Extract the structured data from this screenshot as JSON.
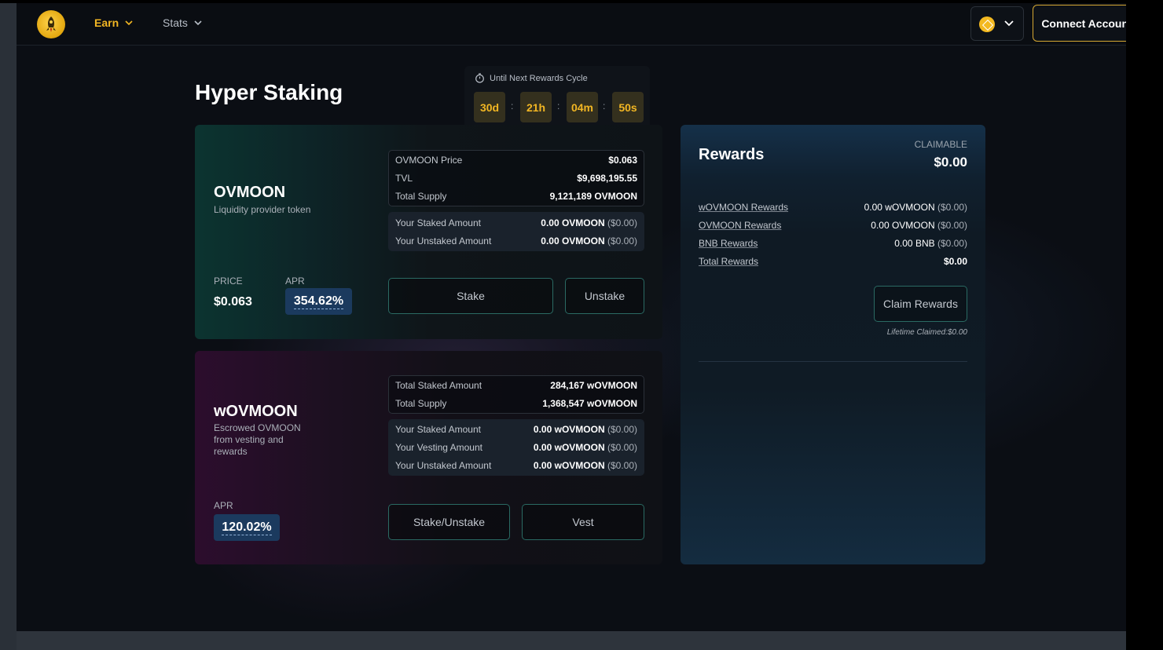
{
  "nav": {
    "earn_label": "Earn",
    "stats_label": "Stats",
    "connect_label": "Connect Account"
  },
  "page": {
    "title": "Hyper Staking"
  },
  "countdown": {
    "label": "Until Next Rewards Cycle",
    "days": "30d",
    "hours": "21h",
    "minutes": "04m",
    "seconds": "50s",
    "sep": ":"
  },
  "ovmoon": {
    "name": "OVMOON",
    "description": "Liquidity provider token",
    "price_label": "PRICE",
    "price": "$0.063",
    "apr_label": "APR",
    "apr": "354.62%",
    "stats": [
      {
        "k": "OVMOON Price",
        "v": "$0.063"
      },
      {
        "k": "TVL",
        "v": "$9,698,195.55"
      },
      {
        "k": "Total Supply",
        "v": "9,121,189 OVMOON"
      }
    ],
    "user": [
      {
        "k": "Your Staked Amount",
        "v": "0.00 OVMOON",
        "usd": "($0.00)"
      },
      {
        "k": "Your Unstaked Amount",
        "v": "0.00 OVMOON",
        "usd": "($0.00)"
      }
    ],
    "stake_label": "Stake",
    "unstake_label": "Unstake"
  },
  "wovmoon": {
    "name": "wOVMOON",
    "description": "Escrowed OVMOON from vesting and rewards",
    "apr_label": "APR",
    "apr": "120.02%",
    "stats": [
      {
        "k": "Total Staked Amount",
        "v": "284,167 wOVMOON"
      },
      {
        "k": "Total Supply",
        "v": "1,368,547 wOVMOON"
      }
    ],
    "user": [
      {
        "k": "Your Staked Amount",
        "v": "0.00 wOVMOON",
        "usd": "($0.00)"
      },
      {
        "k": "Your Vesting Amount",
        "v": "0.00 wOVMOON",
        "usd": "($0.00)"
      },
      {
        "k": "Your Unstaked Amount",
        "v": "0.00 wOVMOON",
        "usd": "($0.00)"
      }
    ],
    "stake_unstake_label": "Stake/Unstake",
    "vest_label": "Vest"
  },
  "rewards": {
    "title": "Rewards",
    "claimable_label": "CLAIMABLE",
    "claimable_value": "$0.00",
    "rows": [
      {
        "k": "wOVMOON Rewards",
        "v": "0.00 wOVMOON",
        "usd": "($0.00)"
      },
      {
        "k": "OVMOON Rewards",
        "v": "0.00 OVMOON",
        "usd": "($0.00)"
      },
      {
        "k": "BNB Rewards",
        "v": "0.00 BNB",
        "usd": "($0.00)"
      },
      {
        "k": "Total Rewards",
        "v": "$0.00",
        "usd": ""
      }
    ],
    "claim_label": "Claim Rewards",
    "lifetime": "Lifetime Claimed:$0.00"
  },
  "colors": {
    "accent_gold": "#f2b623",
    "teal_border": "#2a6a63",
    "apr_badge": "#1b3a5e"
  },
  "icons": {
    "logo": "rocket-coin-icon",
    "chain": "bnb-chain-icon",
    "timer": "stopwatch-icon",
    "dropdown": "chevron-down-icon"
  }
}
